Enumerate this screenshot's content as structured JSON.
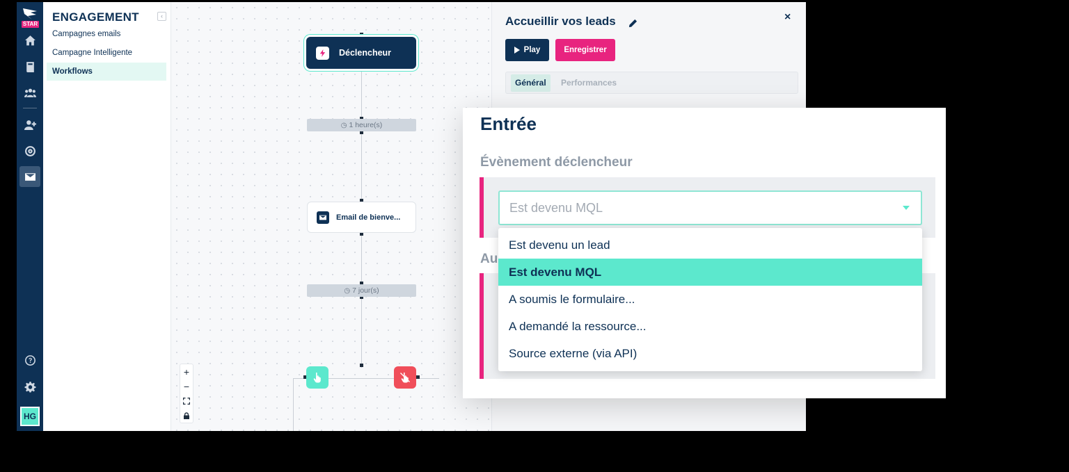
{
  "rail": {
    "logo_text": "STAR",
    "avatar": "HG",
    "icons": [
      "home-icon",
      "book-icon",
      "users-icon",
      "add-user-icon",
      "target-icon",
      "mail-icon",
      "help-icon",
      "gear-icon"
    ]
  },
  "subnav": {
    "title": "ENGAGEMENT",
    "items": [
      {
        "label": "Campagnes emails"
      },
      {
        "label": "Campagne Intelligente"
      },
      {
        "label": "Workflows"
      }
    ]
  },
  "canvas": {
    "trigger_label": "Déclencheur",
    "delay1": "1 heure(s)",
    "email_label": "Email de bienve...",
    "delay2": "7 jour(s)",
    "zoom": [
      "+",
      "−"
    ]
  },
  "panel": {
    "title": "Accueillir vos leads",
    "play_label": "Play",
    "save_label": "Enregistrer",
    "tabs": [
      {
        "label": "Général"
      },
      {
        "label": "Performances"
      }
    ]
  },
  "overlay": {
    "title": "Entrée",
    "event_label": "Évènement déclencheur",
    "second_label": "Au",
    "selected_value": "Est devenu MQL",
    "options": [
      {
        "label": "Est devenu un lead"
      },
      {
        "label": "Est devenu MQL"
      },
      {
        "label": "A soumis le formulaire..."
      },
      {
        "label": "A demandé la ressource..."
      },
      {
        "label": "Source externe (via API)"
      }
    ]
  },
  "colors": {
    "navy": "#0e3155",
    "pink": "#e8247f",
    "teal": "#5ce8cd",
    "red": "#f04e5a"
  }
}
